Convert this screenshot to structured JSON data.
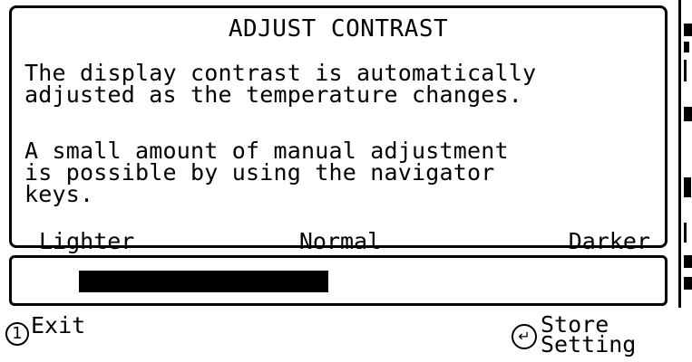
{
  "dialog": {
    "title": "ADJUST CONTRAST",
    "paragraph1": "The display contrast is automatically\nadjusted as the temperature changes.",
    "paragraph2": "A small amount of manual adjustment\nis possible by using the navigator\nkeys.",
    "scale": {
      "left_label": "Lighter",
      "center_label": "Normal",
      "right_label": "Darker"
    },
    "contrast_level_percent": 48
  },
  "footer": {
    "exit_icon": "1-circle-icon",
    "exit_icon_glyph": "1",
    "exit_label": "Exit",
    "store_icon": "enter-circle-icon",
    "store_icon_glyph": "↵",
    "store_label": "Store\nSetting"
  },
  "colors": {
    "foreground": "#000000",
    "background": "#ffffff"
  }
}
